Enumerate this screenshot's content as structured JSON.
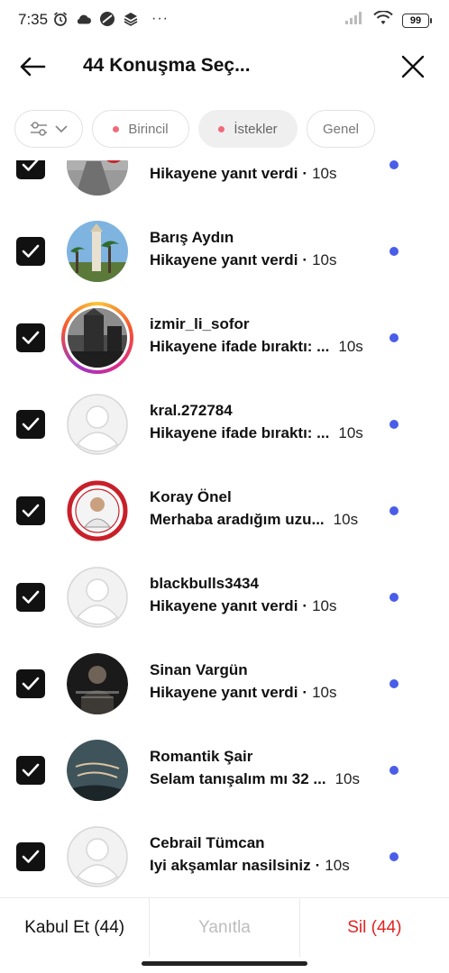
{
  "status_bar": {
    "time": "7:35",
    "battery": "99",
    "icons": [
      "alarm-icon",
      "cloud-icon",
      "app-icon",
      "layers-icon",
      "more-dots-icon",
      "signal-icon",
      "wifi-icon",
      "battery-icon"
    ]
  },
  "header": {
    "title": "44 Konuşma Seç..."
  },
  "filters": {
    "chips": [
      {
        "label": "Birincil"
      },
      {
        "label": "İstekler"
      },
      {
        "label": "Genel"
      }
    ]
  },
  "conversations": [
    {
      "name": "",
      "preview": "Hikayene yanıt verdi",
      "separator": "·",
      "time": "10s"
    },
    {
      "name": "Barış Aydın",
      "preview": "Hikayene yanıt verdi",
      "separator": "·",
      "time": "10s"
    },
    {
      "name": "izmir_li_sofor",
      "preview": "Hikayene ifade bıraktı: ...",
      "separator": "",
      "time": "10s"
    },
    {
      "name": "kral.272784",
      "preview": "Hikayene ifade bıraktı: ...",
      "separator": "",
      "time": "10s"
    },
    {
      "name": "Koray Önel",
      "preview": "Merhaba aradığım uzu...",
      "separator": "",
      "time": "10s"
    },
    {
      "name": "blackbulls3434",
      "preview": "Hikayene yanıt verdi",
      "separator": "·",
      "time": "10s"
    },
    {
      "name": "Sinan Vargün",
      "preview": "Hikayene yanıt verdi",
      "separator": "·",
      "time": "10s"
    },
    {
      "name": "Romantik Şair",
      "preview": "Selam tanışalım mı 32 ...",
      "separator": "",
      "time": "10s"
    },
    {
      "name": "Cebrail Tümcan",
      "preview": "Iyi akşamlar nasilsiniz",
      "separator": "·",
      "time": "10s"
    }
  ],
  "bottom_bar": {
    "accept": "Kabul Et (44)",
    "reply": "Yanıtla",
    "delete": "Sil (44)"
  },
  "colors": {
    "unread_dot": "#4a5de8",
    "delete": "#e02424",
    "chip_dot": "#f06b7a"
  }
}
